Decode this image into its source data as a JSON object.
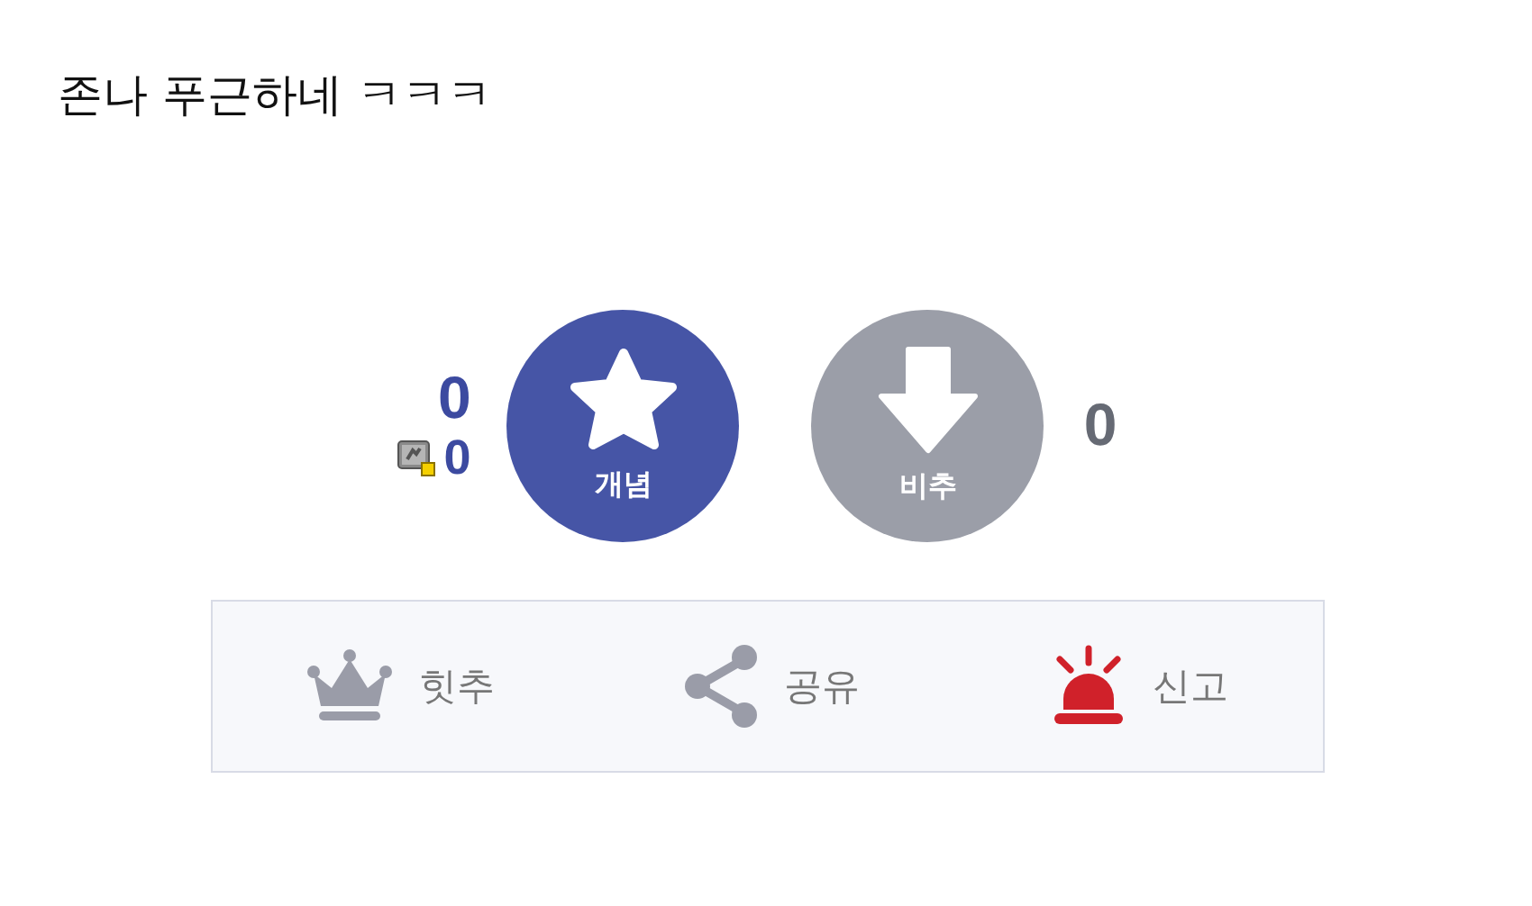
{
  "post": {
    "title": "존나 푸근하네 ㅋㅋㅋ"
  },
  "votes": {
    "up_count": "0",
    "fixed_count": "0",
    "up_label": "개념",
    "down_label": "비추",
    "down_count": "0"
  },
  "actions": [
    {
      "kind": "crown",
      "label": "힛추"
    },
    {
      "kind": "share",
      "label": "공유"
    },
    {
      "kind": "siren",
      "label": "신고"
    }
  ]
}
